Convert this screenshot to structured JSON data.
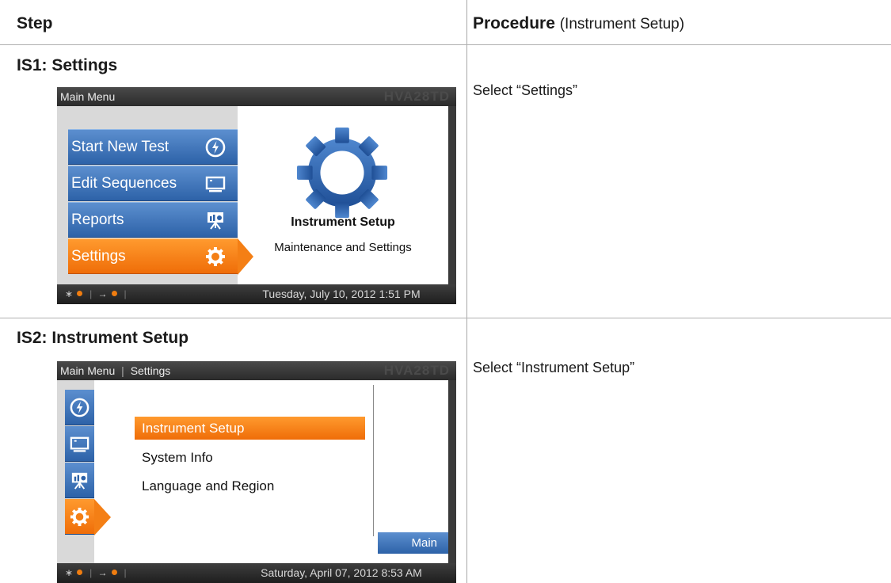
{
  "header": {
    "step": "Step",
    "procedure": "Procedure",
    "procedure_sub": "(Instrument Setup)"
  },
  "steps": [
    {
      "title": "IS1: Settings",
      "instruction": "Select “Settings”",
      "screen": {
        "breadcrumb": "Main Menu",
        "brand": "HVA28TD",
        "menu": [
          {
            "label": "Start New Test",
            "icon": "lightning-icon"
          },
          {
            "label": "Edit Sequences",
            "icon": "monitor-icon"
          },
          {
            "label": "Reports",
            "icon": "chart-easel-icon"
          },
          {
            "label": "Settings",
            "icon": "gear-icon",
            "selected": true
          }
        ],
        "panel_title": "Instrument Setup",
        "panel_subtitle": "Maintenance and Settings",
        "datetime": "Tuesday, July 10, 2012 1:51 PM"
      }
    },
    {
      "title": "IS2: Instrument Setup",
      "instruction": "Select “Instrument Setup”",
      "screen": {
        "breadcrumb_root": "Main Menu",
        "breadcrumb_sep": "|",
        "breadcrumb_current": "Settings",
        "brand": "HVA28TD",
        "options": [
          {
            "label": "Instrument Setup",
            "selected": true
          },
          {
            "label": "System Info"
          },
          {
            "label": "Language and Region"
          }
        ],
        "main_button": "Main",
        "datetime": "Saturday, April 07, 2012 8:53 AM"
      }
    }
  ],
  "colors": {
    "menu_blue": "#2d62a8",
    "menu_orange": "#f47f15",
    "gear_blue": "#2f67b1",
    "status_dot": "#f07d10"
  }
}
